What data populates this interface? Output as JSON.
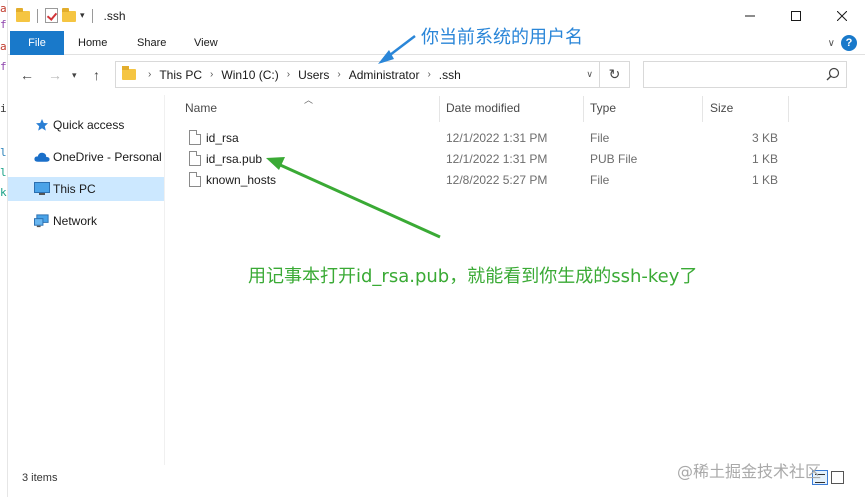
{
  "window": {
    "title": ".ssh",
    "minimize_icon": "minimize-icon",
    "maximize_icon": "maximize-icon",
    "close_icon": "close-icon"
  },
  "ribbon": {
    "tabs": [
      "File",
      "Home",
      "Share",
      "View"
    ],
    "help_label": "?"
  },
  "address": {
    "crumbs": [
      "This PC",
      "Win10 (C:)",
      "Users",
      "Administrator",
      ".ssh"
    ]
  },
  "sidebar": {
    "items": [
      {
        "label": "Quick access",
        "icon": "star-icon"
      },
      {
        "label": "OneDrive - Personal",
        "icon": "cloud-icon"
      },
      {
        "label": "This PC",
        "icon": "computer-icon",
        "selected": true
      },
      {
        "label": "Network",
        "icon": "network-icon"
      }
    ]
  },
  "columns": [
    "Name",
    "Date modified",
    "Type",
    "Size"
  ],
  "files": [
    {
      "name": "id_rsa",
      "date": "12/1/2022 1:31 PM",
      "type": "File",
      "size": "3 KB"
    },
    {
      "name": "id_rsa.pub",
      "date": "12/1/2022 1:31 PM",
      "type": "PUB File",
      "size": "1 KB"
    },
    {
      "name": "known_hosts",
      "date": "12/8/2022 5:27 PM",
      "type": "File",
      "size": "1 KB"
    }
  ],
  "status": {
    "items_count": "3 items"
  },
  "annotations": {
    "username_note": "你当前系统的用户名",
    "open_note": "用记事本打开id_rsa.pub，就能看到你生成的ssh-key了",
    "blue_color": "#2a86d8",
    "green_color": "#3aaa35"
  },
  "watermark": "@稀土掘金技术社区",
  "colors": {
    "accent": "#1979ca",
    "selected": "#cce8ff"
  }
}
